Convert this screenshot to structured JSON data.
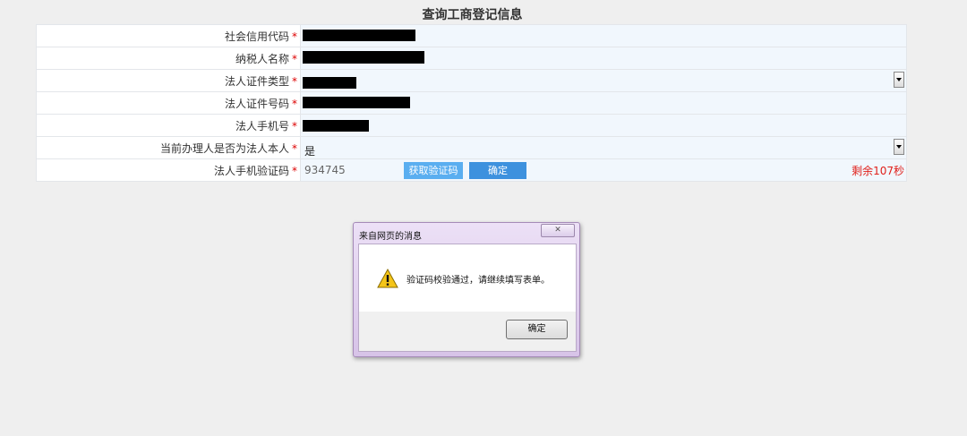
{
  "page": {
    "title": "查询工商登记信息"
  },
  "form": {
    "rows": [
      {
        "label": "社会信用代码"
      },
      {
        "label": "纳税人名称"
      },
      {
        "label": "法人证件类型"
      },
      {
        "label": "法人证件号码"
      },
      {
        "label": "法人手机号"
      },
      {
        "label": "当前办理人是否为法人本人",
        "value": "是"
      },
      {
        "label": "法人手机验证码",
        "value": "934745"
      }
    ],
    "required_mark": "*",
    "sms_button": "获取验证码",
    "confirm_button": "确定",
    "countdown": "剩余107秒"
  },
  "dialog": {
    "title": "来自网页的消息",
    "message": "验证码校验通过，请继续填写表单。",
    "ok_button": "确定",
    "close_icon": "close-icon",
    "warning_icon": "warning-icon"
  },
  "colors": {
    "required": "#dd0000",
    "countdown": "#e0201b",
    "sms_button": "#5aaef0",
    "confirm_button": "#3d91de"
  }
}
